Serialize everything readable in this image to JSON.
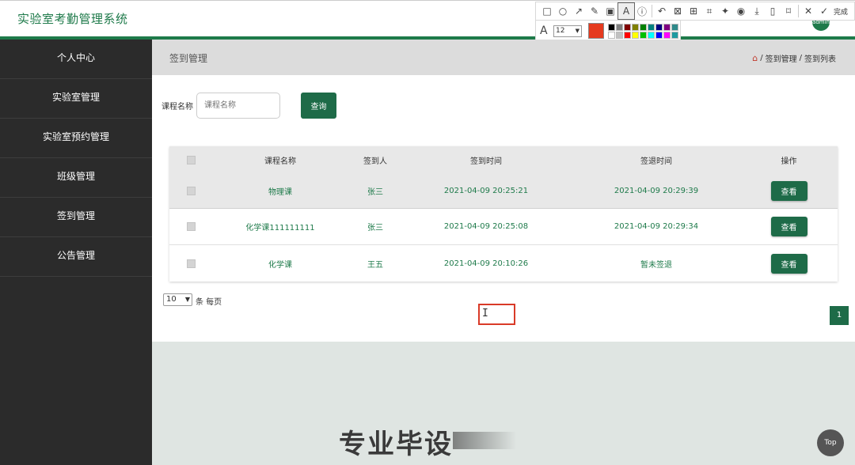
{
  "app": {
    "title": "实验室考勤管理系统"
  },
  "annotation_toolbar": {
    "tools": [
      {
        "name": "rectangle-tool",
        "glyph": "□"
      },
      {
        "name": "ellipse-tool",
        "glyph": "○"
      },
      {
        "name": "arrow-tool",
        "glyph": "↗"
      },
      {
        "name": "pencil-tool",
        "glyph": "✎"
      },
      {
        "name": "mosaic-tool",
        "glyph": "▣"
      },
      {
        "name": "text-tool",
        "glyph": "A"
      },
      {
        "name": "number-tool",
        "glyph": "ⓘ"
      },
      {
        "name": "undo-tool",
        "glyph": "↶"
      },
      {
        "name": "image-tool",
        "glyph": "⊠"
      },
      {
        "name": "ocr-tool",
        "glyph": "⊞"
      },
      {
        "name": "crop-tool",
        "glyph": "⌗"
      },
      {
        "name": "pin-tool",
        "glyph": "✦"
      },
      {
        "name": "record-tool",
        "glyph": "◉"
      },
      {
        "name": "download-tool",
        "glyph": "⤓"
      },
      {
        "name": "long-shot-tool",
        "glyph": "▯"
      },
      {
        "name": "bookmark-tool",
        "glyph": "⌑"
      },
      {
        "name": "close-tool",
        "glyph": "✕"
      },
      {
        "name": "check-tool",
        "glyph": "✓"
      }
    ],
    "done_label": "完成",
    "font_glyph": "A",
    "font_size": "12",
    "current_color": "#e53a1e",
    "swatches": [
      "#000000",
      "#808080",
      "#800000",
      "#808000",
      "#008000",
      "#008080",
      "#000080",
      "#800080",
      "#2f8a8a",
      "#ffffff",
      "#c0c0c0",
      "#ff0000",
      "#ffff00",
      "#00c000",
      "#00ffff",
      "#0000ff",
      "#ff00ff",
      "#1e9aa0"
    ]
  },
  "header": {
    "avatar_text": "admin"
  },
  "sidebar": {
    "items": [
      {
        "label": "个人中心"
      },
      {
        "label": "实验室管理"
      },
      {
        "label": "实验室预约管理"
      },
      {
        "label": "班级管理"
      },
      {
        "label": "签到管理"
      },
      {
        "label": "公告管理"
      }
    ]
  },
  "page": {
    "title": "签到管理",
    "breadcrumb": [
      "签到管理",
      "签到列表"
    ],
    "breadcrumb_sep": "/"
  },
  "search": {
    "label": "课程名称",
    "placeholder": "课程名称",
    "button_label": "查询"
  },
  "table": {
    "columns": [
      "课程名称",
      "签到人",
      "签到时间",
      "签退时间",
      "操作"
    ],
    "rows": [
      {
        "course": "物理课",
        "person": "张三",
        "sign_in": "2021-04-09 20:25:21",
        "sign_out": "2021-04-09 20:29:39",
        "action": "查看"
      },
      {
        "course": "化学课111111111",
        "person": "张三",
        "sign_in": "2021-04-09 20:25:08",
        "sign_out": "2021-04-09 20:29:34",
        "action": "查看"
      },
      {
        "course": "化学课",
        "person": "王五",
        "sign_in": "2021-04-09 20:10:26",
        "sign_out": "暂未签退",
        "action": "查看"
      }
    ]
  },
  "pagination": {
    "page_size": "10",
    "page_size_label": "条 每页",
    "current_page": "1"
  },
  "overlay": {
    "cursor_glyph": "I",
    "watermark": "专业毕设",
    "top_button": "Top"
  },
  "colors": {
    "brand_green": "#1e7a4a",
    "sidebar_bg": "#2b2b2b",
    "accent_red": "#d93a28"
  }
}
